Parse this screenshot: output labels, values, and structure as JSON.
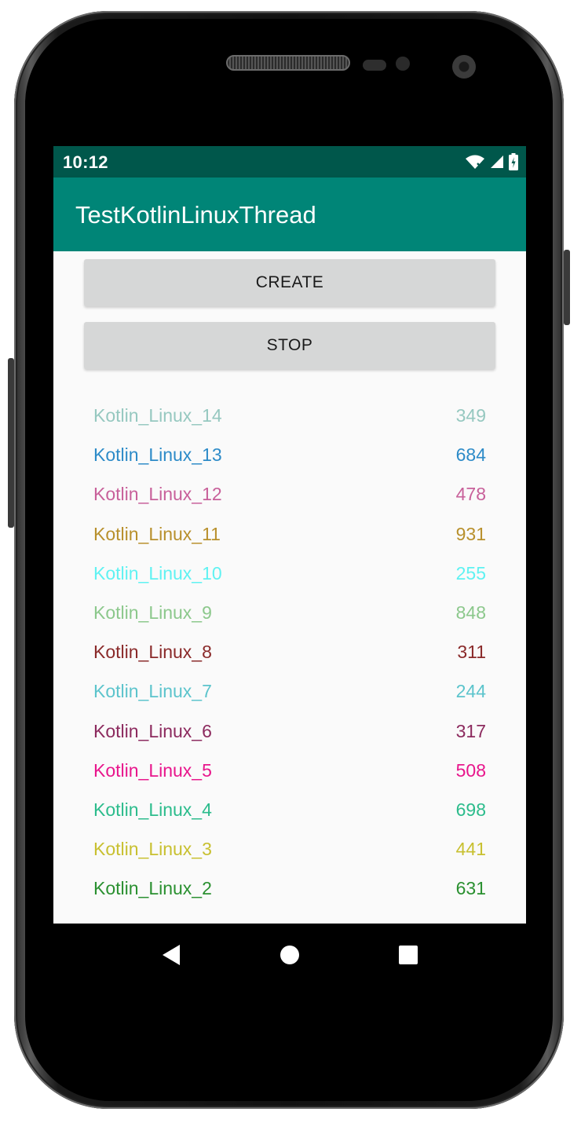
{
  "status_bar": {
    "time": "10:12",
    "icons": [
      "wifi-icon",
      "signal-icon",
      "battery-charging-icon"
    ]
  },
  "app_bar": {
    "title": "TestKotlinLinuxThread"
  },
  "buttons": {
    "create_label": "CREATE",
    "stop_label": "STOP"
  },
  "threads": [
    {
      "name": "Kotlin_Linux_14",
      "value": "349",
      "color": "#96c8c0"
    },
    {
      "name": "Kotlin_Linux_13",
      "value": "684",
      "color": "#2d8bc8"
    },
    {
      "name": "Kotlin_Linux_12",
      "value": "478",
      "color": "#c8609a"
    },
    {
      "name": "Kotlin_Linux_11",
      "value": "931",
      "color": "#b8902c"
    },
    {
      "name": "Kotlin_Linux_10",
      "value": "255",
      "color": "#5ff2f2"
    },
    {
      "name": "Kotlin_Linux_9",
      "value": "848",
      "color": "#8cc88c"
    },
    {
      "name": "Kotlin_Linux_8",
      "value": "311",
      "color": "#8a2a2a"
    },
    {
      "name": "Kotlin_Linux_7",
      "value": "244",
      "color": "#5cc4cc"
    },
    {
      "name": "Kotlin_Linux_6",
      "value": "317",
      "color": "#8c2a5e"
    },
    {
      "name": "Kotlin_Linux_5",
      "value": "508",
      "color": "#e8168c"
    },
    {
      "name": "Kotlin_Linux_4",
      "value": "698",
      "color": "#2cbc8c"
    },
    {
      "name": "Kotlin_Linux_3",
      "value": "441",
      "color": "#c8c030"
    },
    {
      "name": "Kotlin_Linux_2",
      "value": "631",
      "color": "#2a9030"
    }
  ],
  "nav_bar": {
    "icons": [
      "back-icon",
      "home-icon",
      "recent-apps-icon"
    ]
  },
  "colors": {
    "status_bar": "#00574b",
    "app_bar": "#008577",
    "content_bg": "#fafafa",
    "button_bg": "#d6d7d7"
  }
}
